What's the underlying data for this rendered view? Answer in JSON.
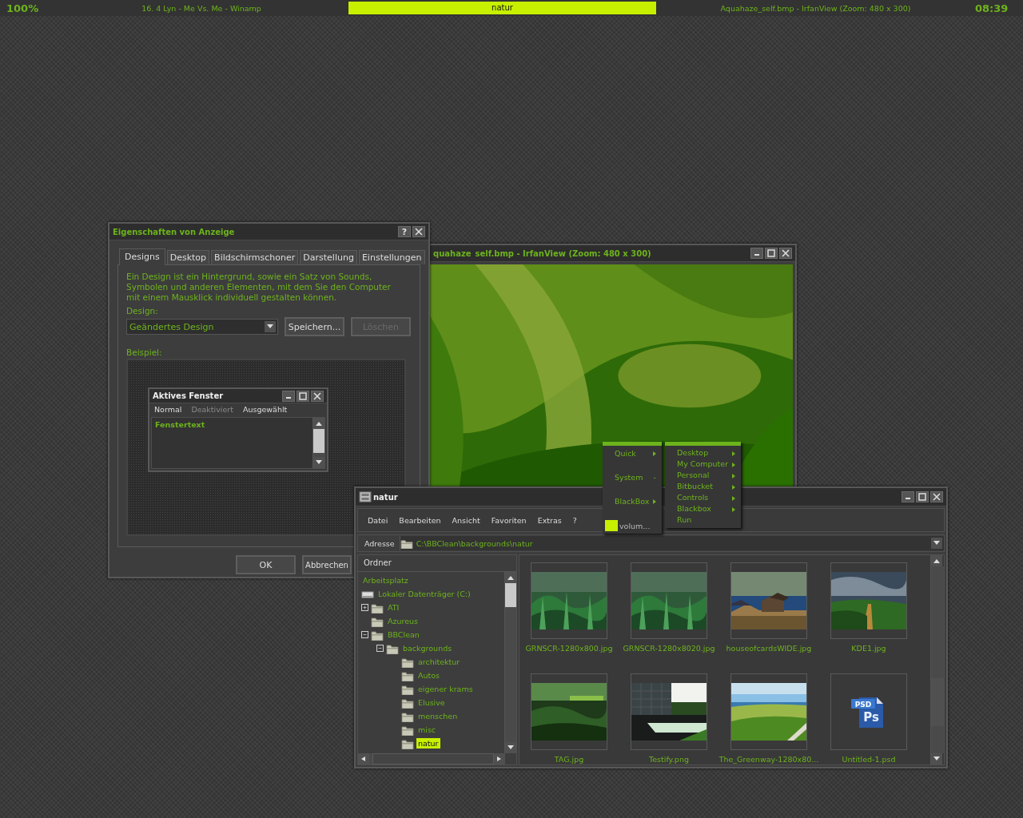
{
  "top_bar": {
    "battery": "100%",
    "now_playing": "16. 4 Lyn - Me Vs. Me - Winamp",
    "workspace": "natur",
    "active_window": "Aquahaze_self.bmp - IrfanView (Zoom: 480 x 300)",
    "clock": "08:39"
  },
  "irfanview": {
    "title": "quahaze_self.bmp - IrfanView (Zoom: 480 x 300)"
  },
  "display_dialog": {
    "title": "Eigenschaften von Anzeige",
    "help": "?",
    "tabs": [
      {
        "label": "Designs",
        "selected": true
      },
      {
        "label": "Desktop",
        "selected": false
      },
      {
        "label": "Bildschirmschoner",
        "selected": false
      },
      {
        "label": "Darstellung",
        "selected": false
      },
      {
        "label": "Einstellungen",
        "selected": false
      }
    ],
    "description": "Ein Design ist ein Hintergrund, sowie ein Satz von Sounds, Symbolen und anderen Elementen, mit dem Sie den Computer mit einem Mausklick individuell gestalten können.",
    "design_label": "Design:",
    "design_value": "Geändertes Design",
    "design_buttons": [
      {
        "label": "Speichern...",
        "disabled": false
      },
      {
        "label": "Löschen",
        "disabled": true
      }
    ],
    "preview_label": "Beispiel:",
    "preview": {
      "title": "Aktives Fenster",
      "menu": [
        {
          "label": "Normal",
          "disabled": false
        },
        {
          "label": "Deaktiviert",
          "disabled": true
        },
        {
          "label": "Ausgewählt",
          "disabled": false
        }
      ],
      "text": "Fenstertext"
    },
    "buttons": [
      "OK",
      "Abbrechen"
    ]
  },
  "menus": [
    {
      "items": [
        {
          "label": "Quick",
          "kind": "submenu"
        },
        {
          "label": "System",
          "kind": "marked",
          "marker": "-"
        },
        {
          "label": "BlackBox",
          "kind": "submenu"
        },
        {
          "label": "volum...",
          "kind": "slider",
          "level": 0.25
        }
      ]
    },
    {
      "items": [
        {
          "label": "Desktop",
          "kind": "submenu"
        },
        {
          "label": "My Computer",
          "kind": "submenu"
        },
        {
          "label": "Personal",
          "kind": "submenu"
        },
        {
          "label": "Bitbucket",
          "kind": "submenu"
        },
        {
          "label": "Controls",
          "kind": "submenu"
        },
        {
          "label": "Blackbox",
          "kind": "submenu"
        },
        {
          "label": "Run",
          "kind": "plain"
        }
      ]
    }
  ],
  "explorer": {
    "title": "natur",
    "menu": [
      "Datei",
      "Bearbeiten",
      "Ansicht",
      "Favoriten",
      "Extras",
      "?"
    ],
    "address_label": "Adresse",
    "address": "C:\\BBClean\\backgrounds\\natur",
    "folders_header": "Ordner",
    "tree": [
      {
        "label": "Arbeitsplatz",
        "selected": false,
        "children": [
          {
            "label": "Lokaler Datenträger (C:)",
            "kind": "drive",
            "selected": false,
            "children": [
              {
                "label": "ATI",
                "kind": "folder",
                "selected": false,
                "expanded": false
              },
              {
                "label": "Azureus",
                "kind": "folder",
                "selected": false
              },
              {
                "label": "BBClean",
                "kind": "folder",
                "selected": false,
                "expanded": true,
                "children": [
                  {
                    "label": "backgrounds",
                    "kind": "folder",
                    "selected": false,
                    "expanded": true,
                    "children": [
                      {
                        "label": "architektur",
                        "kind": "folder",
                        "selected": false
                      },
                      {
                        "label": "Autos",
                        "kind": "folder",
                        "selected": false
                      },
                      {
                        "label": "eigener krams",
                        "kind": "folder",
                        "selected": false
                      },
                      {
                        "label": "Elusive",
                        "kind": "folder",
                        "selected": false
                      },
                      {
                        "label": "menschen",
                        "kind": "folder",
                        "selected": false
                      },
                      {
                        "label": "misc",
                        "kind": "folder",
                        "selected": false
                      },
                      {
                        "label": "natur",
                        "kind": "folder",
                        "selected": true
                      }
                    ]
                  }
                ]
              }
            ]
          }
        ]
      }
    ],
    "files": [
      {
        "name": "GRNSCR-1280x800.jpg",
        "kind": "picture"
      },
      {
        "name": "GRNSCR-1280x8020.jpg",
        "kind": "picture"
      },
      {
        "name": "houseofcardsWIDE.jpg",
        "kind": "picture"
      },
      {
        "name": "KDE1.jpg",
        "kind": "picture"
      },
      {
        "name": "TAG.jpg",
        "kind": "picture"
      },
      {
        "name": "Testify.png",
        "kind": "picture"
      },
      {
        "name": "The_Greenway-1280x80...",
        "kind": "picture"
      },
      {
        "name": "Untitled-1.psd",
        "kind": "psd",
        "badge": "PSD",
        "mark": "Ps"
      }
    ]
  }
}
